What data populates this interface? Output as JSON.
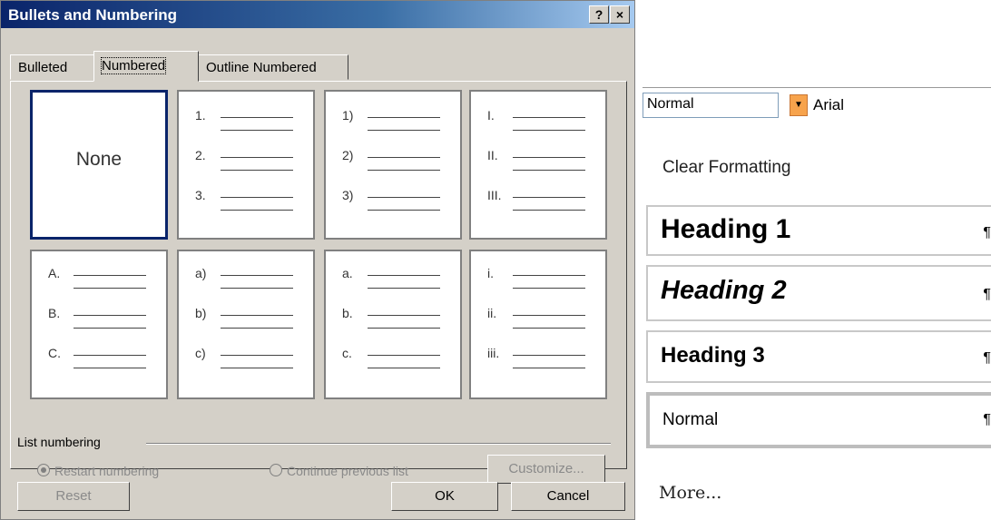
{
  "dialog": {
    "title": "Bullets and Numbering",
    "help_icon": "?",
    "close_icon": "×",
    "tabs": [
      {
        "label": "Bulleted",
        "active": false
      },
      {
        "label": "Numbered",
        "active": true
      },
      {
        "label": "Outline Numbered",
        "active": false
      }
    ],
    "options": [
      {
        "type": "none",
        "label": "None",
        "selected": true
      },
      {
        "type": "list",
        "markers": [
          "1.",
          "2.",
          "3."
        ]
      },
      {
        "type": "list",
        "markers": [
          "1)",
          "2)",
          "3)"
        ]
      },
      {
        "type": "list",
        "markers": [
          "I.",
          "II.",
          "III."
        ]
      },
      {
        "type": "list",
        "markers": [
          "A.",
          "B.",
          "C."
        ]
      },
      {
        "type": "list",
        "markers": [
          "a)",
          "b)",
          "c)"
        ]
      },
      {
        "type": "list",
        "markers": [
          "a.",
          "b.",
          "c."
        ]
      },
      {
        "type": "list",
        "markers": [
          "i.",
          "ii.",
          "iii."
        ]
      }
    ],
    "list_numbering_label": "List numbering",
    "restart_label": "Restart numbering",
    "continue_label": "Continue previous list",
    "restart_selected": true,
    "customize_label": "Customize...",
    "reset_label": "Reset",
    "ok_label": "OK",
    "cancel_label": "Cancel"
  },
  "styles_panel": {
    "style_value": "Normal",
    "font_value": "Arial",
    "clear_formatting": "Clear Formatting",
    "styles": [
      {
        "label": "Heading 1",
        "mark": "¶"
      },
      {
        "label": "Heading 2",
        "mark": "¶"
      },
      {
        "label": "Heading 3",
        "mark": "¶"
      },
      {
        "label": "Normal",
        "mark": "¶"
      }
    ],
    "more_label": "More..."
  },
  "colors": {
    "titlebar": "#0a246a",
    "dialog_bg": "#d4d0c8",
    "dropdown_accent": "#f7a34c"
  }
}
